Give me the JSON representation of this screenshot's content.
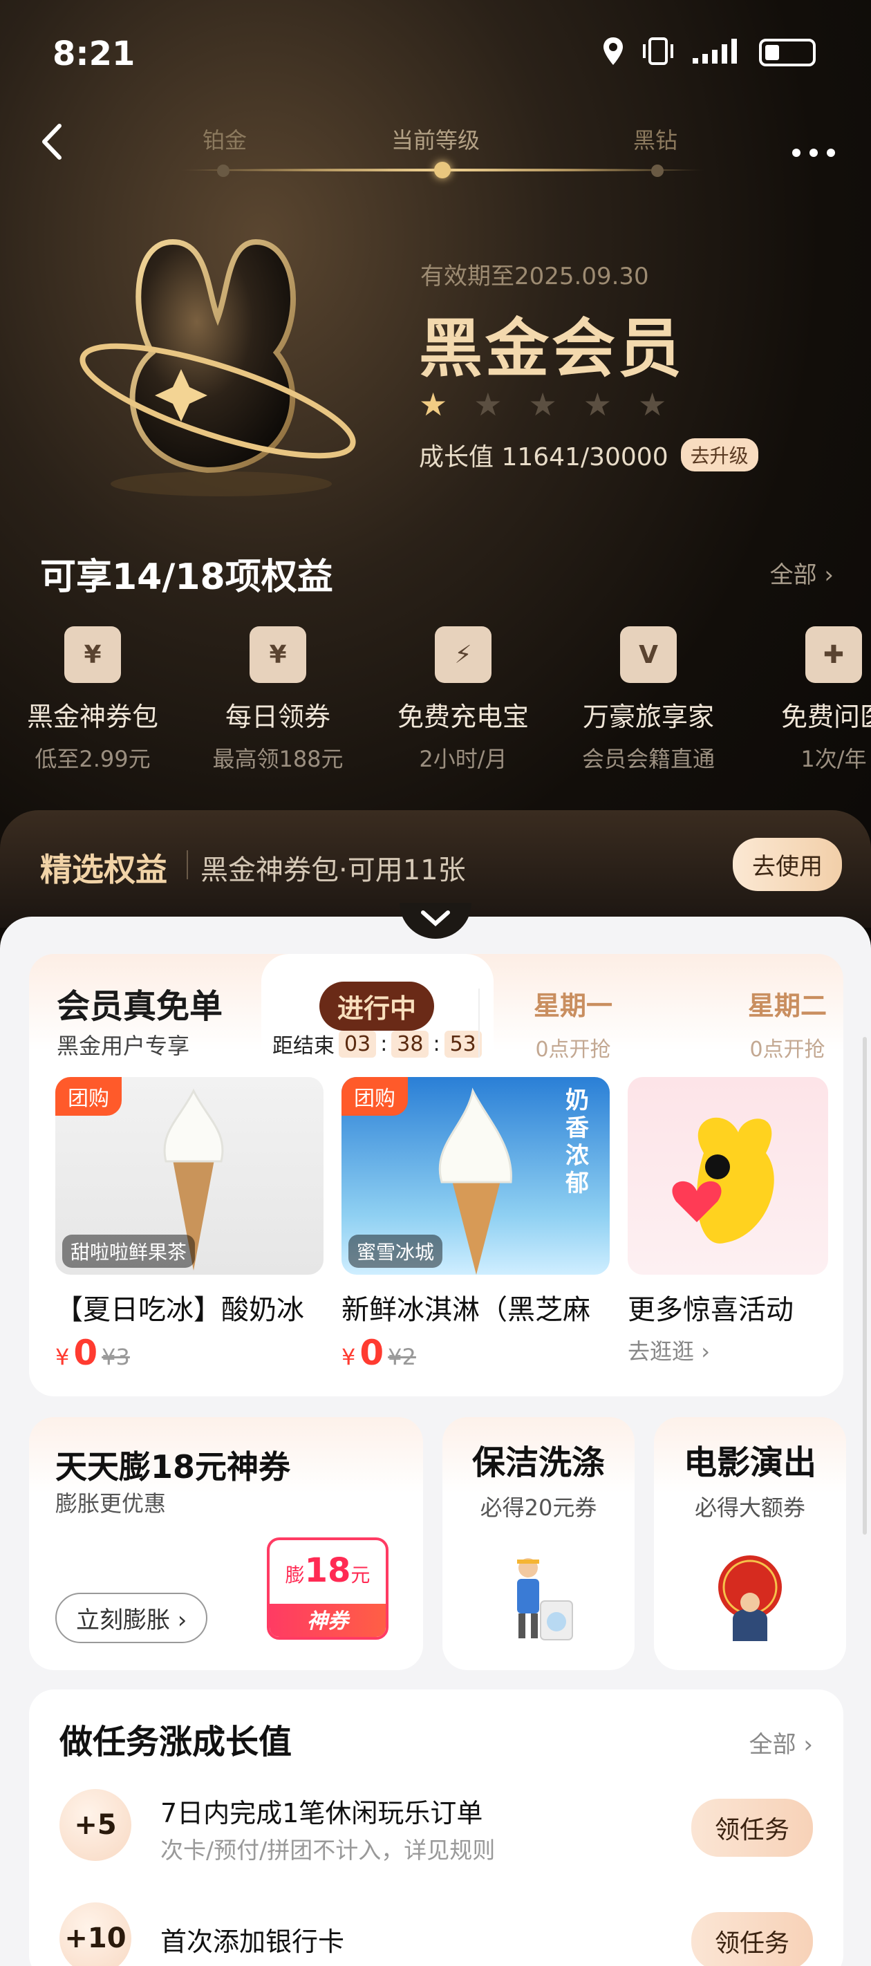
{
  "status": {
    "time": "8:21"
  },
  "level": {
    "left": "铂金",
    "current": "当前等级",
    "right": "黑钻"
  },
  "membership": {
    "expiry": "有效期至2025.09.30",
    "title": "黑金会员",
    "stars_on": 1,
    "stars_total": 5,
    "growth_text": "成长值 11641/30000",
    "growth_current": 11641,
    "growth_target": 30000,
    "upgrade": "去升级"
  },
  "benefits": {
    "title": "可享14/18项权益",
    "all": "全部",
    "items": [
      {
        "name": "黑金神券包",
        "sub": "低至2.99元",
        "icon": "¥"
      },
      {
        "name": "每日领券",
        "sub": "最高领188元",
        "icon": "¥"
      },
      {
        "name": "免费充电宝",
        "sub": "2小时/月",
        "icon": "⚡"
      },
      {
        "name": "万豪旅享家",
        "sub": "会员会籍直通",
        "icon": "V"
      },
      {
        "name": "免费问医",
        "sub": "1次/年",
        "icon": "✚"
      }
    ]
  },
  "selected": {
    "label": "精选权益",
    "desc": "黑金神券包·可用11张",
    "button": "去使用"
  },
  "free": {
    "title": "会员真免单",
    "sub": "黑金用户专享",
    "status": "进行中",
    "countdown_label": "距结束",
    "countdown": [
      "03",
      "38",
      "53"
    ],
    "days": [
      {
        "day": "星期一",
        "time": "0点开抢"
      },
      {
        "day": "星期二",
        "time": "0点开抢"
      }
    ],
    "products": [
      {
        "tag": "团购",
        "shop": "甜啦啦鲜果茶",
        "name": "【夏日吃冰】酸奶冰",
        "currency": "¥",
        "price": "0",
        "original": "¥3"
      },
      {
        "tag": "团购",
        "shop": "蜜雪冰城",
        "name": "新鲜冰淇淋（黑芝麻",
        "currency": "¥",
        "price": "0",
        "original": "¥2",
        "banner": "奶香浓郁"
      },
      {
        "name": "更多惊喜活动",
        "link": "去逛逛"
      }
    ]
  },
  "swell": {
    "title": "天天膨18元神券",
    "sub": "膨胀更优惠",
    "button": "立刻膨胀",
    "coupon_prefix": "膨",
    "coupon_amount": "18",
    "coupon_unit": "元",
    "coupon_label": "神券"
  },
  "cleaning": {
    "title": "保洁洗涤",
    "sub": "必得20元券"
  },
  "movie": {
    "title": "电影演出",
    "sub": "必得大额券"
  },
  "tasks": {
    "title": "做任务涨成长值",
    "all": "全部",
    "items": [
      {
        "points": "+5",
        "title": "7日内完成1笔休闲玩乐订单",
        "sub": "次卡/预付/拼团不计入，详见规则",
        "button": "领任务"
      },
      {
        "points": "+10",
        "title": "首次添加银行卡",
        "sub": "",
        "button": "领任务"
      }
    ]
  },
  "colors": {
    "gold": "#f3d9ae",
    "accent_red": "#ff3b30",
    "brown": "#6a2a17"
  }
}
